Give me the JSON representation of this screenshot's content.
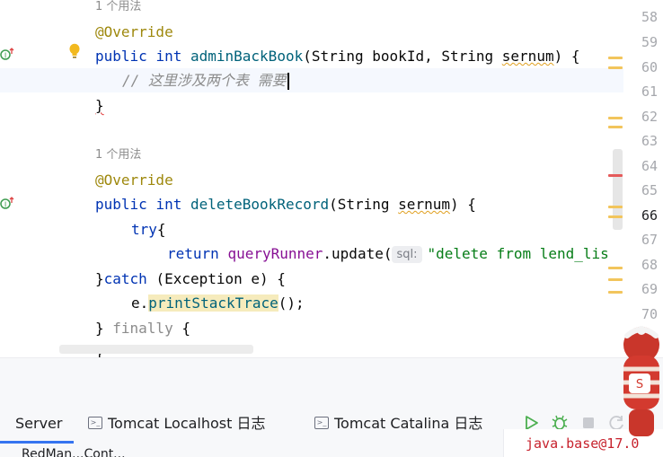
{
  "code": {
    "usage_hint_1": "1 个用法",
    "override_1": "@Override",
    "method1": {
      "kw_public": "public",
      "kw_int": "int",
      "name": "adminBackBook",
      "params": "(String bookId, String ",
      "param_last": "sernum",
      "close": ") {"
    },
    "comment_line": "// 这里涉及两个表 需要",
    "close_brace_1": "}",
    "usage_hint_2": "1 个用法",
    "override_2": "@Override",
    "method2": {
      "kw_public": "public",
      "kw_int": "int",
      "name": "deleteBookRecord",
      "params": "(String ",
      "param_last": "sernum",
      "close": ") {"
    },
    "try_kw": "try",
    "try_brace": "{",
    "return_kw": "return",
    "return_field": "queryRunner",
    "return_call": ".update(",
    "sql_hint": "sql:",
    "sql_string": "\"delete from lend_lis",
    "catch_open": "}",
    "catch_kw": "catch",
    "catch_rest": " (Exception e) {",
    "print_obj": "e.",
    "print_call": "printStackTrace",
    "print_end": "();",
    "finally_open": "} ",
    "finally_kw": "finally",
    "finally_rest": " {",
    "last_brace": "}"
  },
  "line_numbers": [
    "58",
    "59",
    "60",
    "61",
    "62",
    "63",
    "64",
    "65",
    "66",
    "67",
    "68",
    "69",
    "70"
  ],
  "active_line": "66",
  "tool_window": {
    "tabs": [
      "Server",
      "Tomcat Localhost 日志",
      "Tomcat Catalina 日志"
    ],
    "bottom_text": "RedMan...Cont...",
    "output_text": "java.base@17.0"
  },
  "colors": {
    "accent": "#3574f0",
    "keyword": "#0033b3",
    "method": "#00627a",
    "annotation": "#9e880d",
    "string": "#067d17",
    "field": "#871094",
    "run_green": "#4caf50"
  }
}
